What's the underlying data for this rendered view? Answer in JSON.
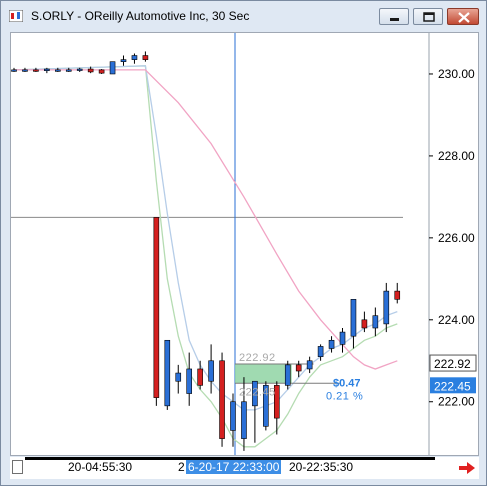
{
  "window": {
    "title": "S.ORLY - OReilly Automotive Inc, 30 Sec",
    "minimize_label": "minimize",
    "maximize_label": "maximize",
    "close_label": "close"
  },
  "colors": {
    "up_candle": "#2a6fd6",
    "down_candle": "#d42020",
    "ma_fast": "#b5dcb2",
    "ma_mid": "#b6cde8",
    "ma_slow": "#f1a4c4",
    "price_box_blue": "#2a7fe0",
    "highlight_green": "#8fd3a3"
  },
  "chart_data": {
    "type": "candlestick",
    "symbol": "S.ORLY",
    "interval": "30 Sec",
    "ylim": [
      220.7,
      231.0
    ],
    "yticks": [
      "230.00",
      "228.00",
      "226.00",
      "224.00",
      "222.00"
    ],
    "xticks": [
      "20-04:55:30",
      "6-20-17 22:33:00",
      "20-22:35:30"
    ],
    "selected_xtick": "6-20-17 22:33:00",
    "candles": [
      {
        "o": 230.1,
        "h": 230.15,
        "l": 230.05,
        "c": 230.1
      },
      {
        "o": 230.1,
        "h": 230.15,
        "l": 230.05,
        "c": 230.1
      },
      {
        "o": 230.1,
        "h": 230.15,
        "l": 230.05,
        "c": 230.08
      },
      {
        "o": 230.08,
        "h": 230.15,
        "l": 230.02,
        "c": 230.12
      },
      {
        "o": 230.1,
        "h": 230.15,
        "l": 230.05,
        "c": 230.1
      },
      {
        "o": 230.1,
        "h": 230.15,
        "l": 230.05,
        "c": 230.1
      },
      {
        "o": 230.1,
        "h": 230.15,
        "l": 230.05,
        "c": 230.12
      },
      {
        "o": 230.12,
        "h": 230.18,
        "l": 230.02,
        "c": 230.05
      },
      {
        "o": 230.1,
        "h": 230.12,
        "l": 230.0,
        "c": 230.02
      },
      {
        "o": 230.0,
        "h": 230.3,
        "l": 230.0,
        "c": 230.3
      },
      {
        "o": 230.3,
        "h": 230.45,
        "l": 230.2,
        "c": 230.35
      },
      {
        "o": 230.35,
        "h": 230.5,
        "l": 230.25,
        "c": 230.45
      },
      {
        "o": 230.45,
        "h": 230.55,
        "l": 230.3,
        "c": 230.35
      },
      {
        "o": 226.5,
        "h": 226.5,
        "l": 221.9,
        "c": 222.1
      },
      {
        "o": 221.9,
        "h": 223.5,
        "l": 221.8,
        "c": 223.5
      },
      {
        "o": 222.5,
        "h": 222.9,
        "l": 222.2,
        "c": 222.7
      },
      {
        "o": 222.2,
        "h": 223.2,
        "l": 221.9,
        "c": 222.8
      },
      {
        "o": 222.8,
        "h": 223.0,
        "l": 222.3,
        "c": 222.4
      },
      {
        "o": 222.5,
        "h": 223.4,
        "l": 222.2,
        "c": 223.0
      },
      {
        "o": 223.0,
        "h": 223.2,
        "l": 220.9,
        "c": 221.1
      },
      {
        "o": 221.3,
        "h": 222.2,
        "l": 220.9,
        "c": 222.0
      },
      {
        "o": 221.1,
        "h": 222.6,
        "l": 220.8,
        "c": 222.0
      },
      {
        "o": 221.9,
        "h": 222.5,
        "l": 221.0,
        "c": 222.5
      },
      {
        "o": 221.4,
        "h": 222.5,
        "l": 221.3,
        "c": 222.4
      },
      {
        "o": 222.4,
        "h": 222.5,
        "l": 221.2,
        "c": 221.6
      },
      {
        "o": 222.4,
        "h": 223.0,
        "l": 222.3,
        "c": 222.9
      },
      {
        "o": 222.9,
        "h": 223.0,
        "l": 222.6,
        "c": 222.75
      },
      {
        "o": 222.8,
        "h": 223.1,
        "l": 222.7,
        "c": 223.0
      },
      {
        "o": 223.1,
        "h": 223.4,
        "l": 223.0,
        "c": 223.35
      },
      {
        "o": 223.3,
        "h": 223.6,
        "l": 223.2,
        "c": 223.5
      },
      {
        "o": 223.4,
        "h": 223.8,
        "l": 223.2,
        "c": 223.7
      },
      {
        "o": 223.6,
        "h": 224.5,
        "l": 223.3,
        "c": 224.5
      },
      {
        "o": 224.0,
        "h": 224.2,
        "l": 223.7,
        "c": 223.8
      },
      {
        "o": 223.8,
        "h": 224.3,
        "l": 223.6,
        "c": 224.1
      },
      {
        "o": 223.9,
        "h": 224.9,
        "l": 223.7,
        "c": 224.7
      },
      {
        "o": 224.7,
        "h": 224.9,
        "l": 224.4,
        "c": 224.5
      }
    ],
    "moving_averages": [
      {
        "color": "#b5dcb2",
        "points": [
          [
            0,
            230.1
          ],
          [
            12,
            230.2
          ],
          [
            13,
            227.4
          ],
          [
            14,
            225.0
          ],
          [
            15,
            223.6
          ],
          [
            16,
            222.7
          ],
          [
            17,
            222.3
          ],
          [
            18,
            222.0
          ],
          [
            19,
            221.6
          ],
          [
            20,
            221.1
          ],
          [
            21,
            220.9
          ],
          [
            22,
            220.9
          ],
          [
            23,
            221.1
          ],
          [
            24,
            221.3
          ],
          [
            25,
            221.7
          ],
          [
            26,
            222.2
          ],
          [
            27,
            222.6
          ],
          [
            28,
            222.9
          ],
          [
            29,
            223.0
          ],
          [
            30,
            223.1
          ],
          [
            31,
            223.3
          ],
          [
            32,
            223.5
          ],
          [
            33,
            223.6
          ],
          [
            34,
            223.8
          ],
          [
            35,
            223.9
          ]
        ]
      },
      {
        "color": "#b6cde8",
        "points": [
          [
            0,
            230.1
          ],
          [
            12,
            230.2
          ],
          [
            13,
            228.5
          ],
          [
            14,
            226.6
          ],
          [
            15,
            224.9
          ],
          [
            16,
            223.5
          ],
          [
            17,
            222.9
          ],
          [
            18,
            222.5
          ],
          [
            19,
            222.2
          ],
          [
            20,
            222.0
          ],
          [
            21,
            221.8
          ],
          [
            22,
            221.8
          ],
          [
            23,
            221.9
          ],
          [
            24,
            222.0
          ],
          [
            25,
            222.3
          ],
          [
            26,
            222.6
          ],
          [
            27,
            222.9
          ],
          [
            28,
            223.1
          ],
          [
            29,
            223.3
          ],
          [
            30,
            223.4
          ],
          [
            31,
            223.6
          ],
          [
            32,
            223.8
          ],
          [
            33,
            223.9
          ],
          [
            34,
            224.1
          ],
          [
            35,
            224.2
          ]
        ]
      },
      {
        "color": "#f1a4c4",
        "points": [
          [
            0,
            230.1
          ],
          [
            12,
            230.1
          ],
          [
            15,
            229.3
          ],
          [
            18,
            228.3
          ],
          [
            21,
            227.0
          ],
          [
            24,
            225.6
          ],
          [
            26,
            224.7
          ],
          [
            28,
            224.0
          ],
          [
            30,
            223.4
          ],
          [
            31,
            223.1
          ],
          [
            32,
            222.9
          ],
          [
            33,
            222.8
          ],
          [
            34,
            222.9
          ],
          [
            35,
            223.0
          ]
        ]
      }
    ],
    "horizontal_line": 226.5,
    "vertical_line_at_candle": 20,
    "price_labels": [
      {
        "text": "222.92",
        "value": 222.92,
        "style": "outline"
      },
      {
        "text": "222.45",
        "value": 222.45,
        "style": "filled"
      }
    ],
    "annotation": {
      "range_top": 222.92,
      "range_bottom": 222.45,
      "top_label": "222.92",
      "bottom_label": "222.45",
      "change_text": "$0.47",
      "percent_text": "0.21 %"
    }
  }
}
